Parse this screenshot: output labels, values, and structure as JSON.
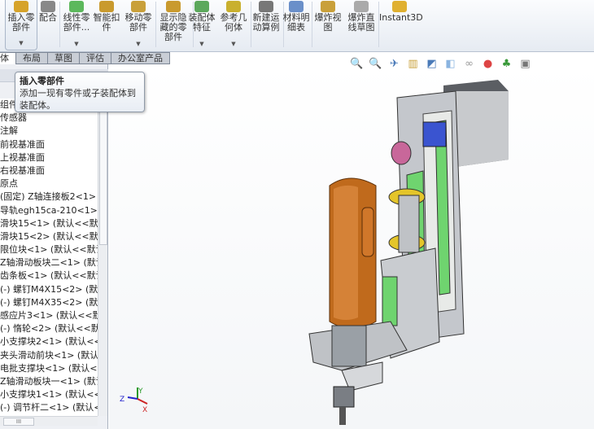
{
  "toolbar": {
    "buttons": [
      {
        "label": "插入零\n部件",
        "l1": "插入零",
        "l2": "部件",
        "icon": "insert-component-icon"
      },
      {
        "l1": "配合",
        "l2": "",
        "icon": "mate-icon"
      },
      {
        "l1": "线性零",
        "l2": "部件...",
        "icon": "linear-pattern-icon"
      },
      {
        "l1": "智能扣",
        "l2": "件",
        "icon": "smart-fastener-icon"
      },
      {
        "l1": "移动零",
        "l2": "部件",
        "icon": "move-component-icon"
      },
      {
        "l1": "显示隐",
        "l2": "藏的零",
        "l3": "部件",
        "icon": "show-hidden-icon"
      },
      {
        "l1": "装配体",
        "l2": "特征",
        "icon": "assembly-feature-icon"
      },
      {
        "l1": "参考几",
        "l2": "何体",
        "icon": "reference-geometry-icon"
      },
      {
        "l1": "新建运",
        "l2": "动算例",
        "icon": "motion-study-icon"
      },
      {
        "l1": "材料明",
        "l2": "细表",
        "icon": "bom-icon"
      },
      {
        "l1": "爆炸视",
        "l2": "图",
        "icon": "exploded-view-icon"
      },
      {
        "l1": "爆炸直",
        "l2": "线草图",
        "icon": "explode-line-sketch-icon"
      },
      {
        "l1": "Instant3D",
        "l2": "",
        "icon": "instant3d-icon"
      }
    ]
  },
  "tabs": [
    "体",
    "布局",
    "草图",
    "评估",
    "办公室产品"
  ],
  "tooltip": {
    "title": "插入零部件",
    "line1": "添加一现有零件或子装配体到",
    "line2": "装配体。"
  },
  "tree": [
    "组件",
    "传感器",
    "注解",
    "前视基准面",
    "上视基准面",
    "右视基准面",
    "原点",
    "(固定) Z轴连接板2<1> (默",
    "导轨egh15ca-210<1> (默",
    "滑块15<1> (默认<<默认",
    "滑块15<2> (默认<<默认",
    "限位块<1> (默认<<默认",
    "Z轴滑动板块二<1> (默认",
    "齿条板<1> (默认<<默认",
    "(-) 螺钉M4X15<2> (默认",
    "(-) 螺钉M4X35<2> (默认",
    "感应片3<1> (默认<<默认",
    "(-) 惰轮<2> (默认<<默认",
    "小支撑块2<1> (默认<<默",
    "夹头滑动前块<1> (默认<",
    "电批支撑块<1> (默认<<",
    "Z轴滑动板块一<1> (默认",
    "小支撑块1<1> (默认<<默",
    "(-) 调节杆二<1> (默认<<",
    "(-) 调节杆一<1> (默认<<"
  ],
  "view_tools": [
    "zoom-to-fit-icon",
    "zoom-area-icon",
    "previous-view-icon",
    "section-view-icon",
    "view-orientation-icon",
    "display-style-icon",
    "hide-show-icon",
    "edit-appearance-icon",
    "apply-scene-icon",
    "view-settings-icon"
  ],
  "triad": {
    "x": "X",
    "y": "Y",
    "z": "Z"
  },
  "colors": {
    "accent": "#3d6fb6",
    "orange": "#c8661a",
    "green": "#5fc25f"
  }
}
